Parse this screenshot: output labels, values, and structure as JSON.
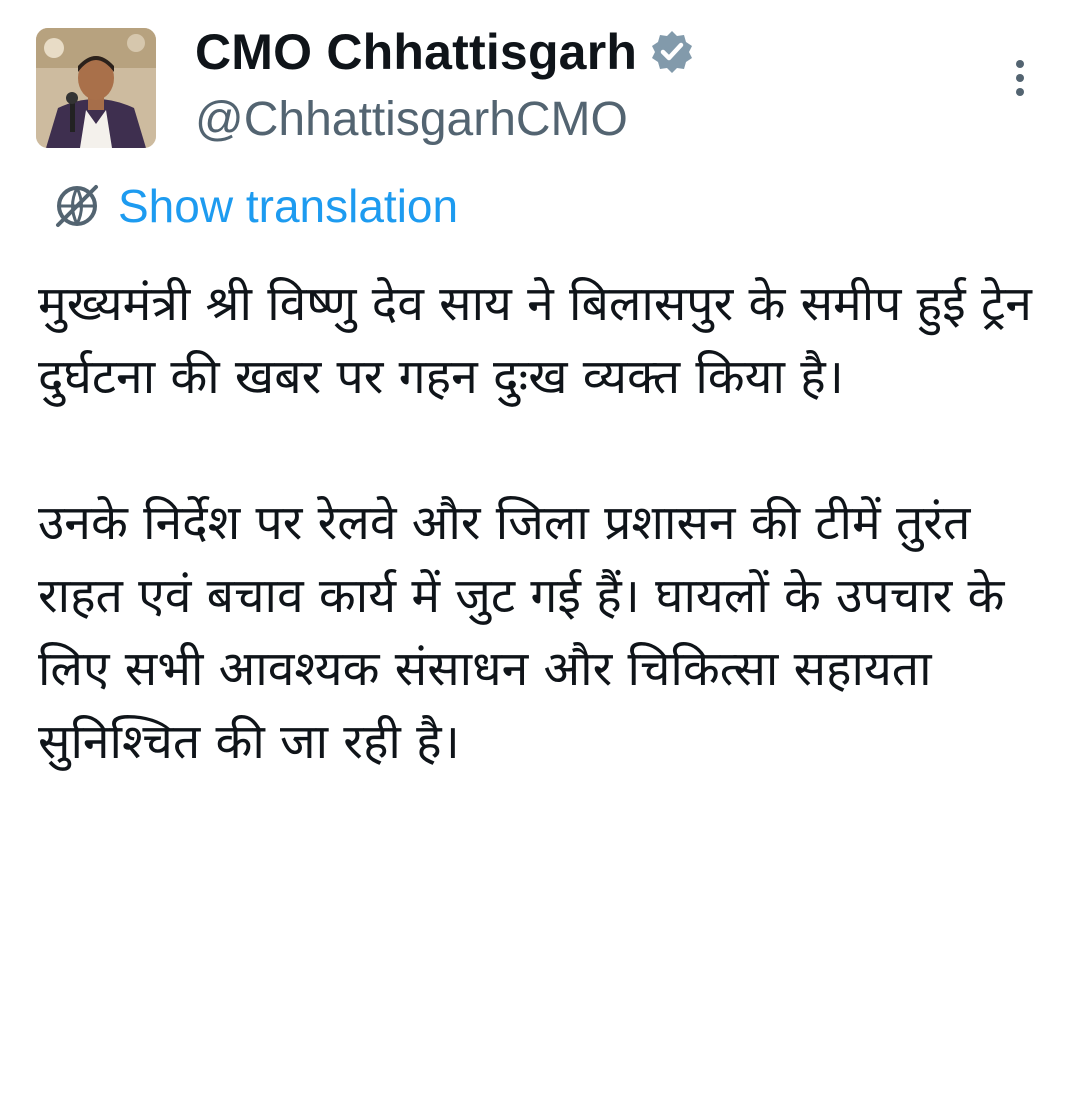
{
  "tweet": {
    "author": {
      "display_name": "CMO Chhattisgarh",
      "handle": "@ChhattisgarhCMO",
      "verified_icon": "verified-badge-icon",
      "badge_color": "#829aab"
    },
    "more_icon": "more-vertical-icon",
    "translation": {
      "icon": "globe-translate-icon",
      "label": "Show translation",
      "color": "#1d9bf0"
    },
    "body": {
      "paragraph_1": "मुख्यमंत्री श्री विष्णु देव साय ने बिलासपुर के समीप हुई ट्रेन दुर्घटना की खबर पर गहन दुःख व्यक्त किया है।",
      "paragraph_2": "उनके निर्देश पर रेलवे और जिला प्रशासन की टीमें तुरंत राहत एवं बचाव कार्य में जुट गई हैं। घायलों के उपचार के लिए सभी आवश्यक संसाधन और चिकित्सा सहायता सुनिश्चित की जा रही है।"
    }
  }
}
